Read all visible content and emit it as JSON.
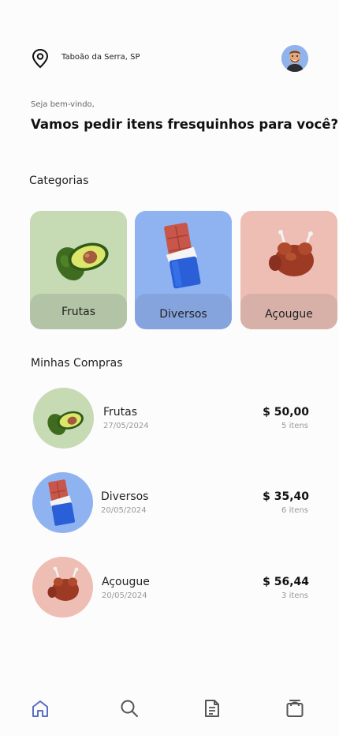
{
  "header": {
    "location": "Taboão da Serra, SP",
    "welcome": "Seja bem-vindo,",
    "headline": "Vamos pedir itens fresquinhos para você?"
  },
  "categories": {
    "title": "Categorias",
    "items": [
      {
        "label": "Frutas",
        "icon": "avocado-icon",
        "color": "#c6dab3"
      },
      {
        "label": "Diversos",
        "icon": "chocolate-icon",
        "color": "#8fb3f0"
      },
      {
        "label": "Açougue",
        "icon": "roast-chicken-icon",
        "color": "#eebdb3"
      }
    ]
  },
  "purchases": {
    "title": "Minhas Compras",
    "items": [
      {
        "name": "Frutas",
        "date": "27/05/2024",
        "price": "$ 50,00",
        "count": "5 itens"
      },
      {
        "name": "Diversos",
        "date": "20/05/2024",
        "price": "$ 35,40",
        "count": "6 itens"
      },
      {
        "name": "Açougue",
        "date": "20/05/2024",
        "price": "$ 56,44",
        "count": "3 itens"
      }
    ]
  },
  "nav": {
    "items": [
      "home-icon",
      "search-icon",
      "document-icon",
      "bag-icon"
    ],
    "active": "home-icon",
    "active_color": "#5b6fbf",
    "inactive_color": "#555555"
  }
}
